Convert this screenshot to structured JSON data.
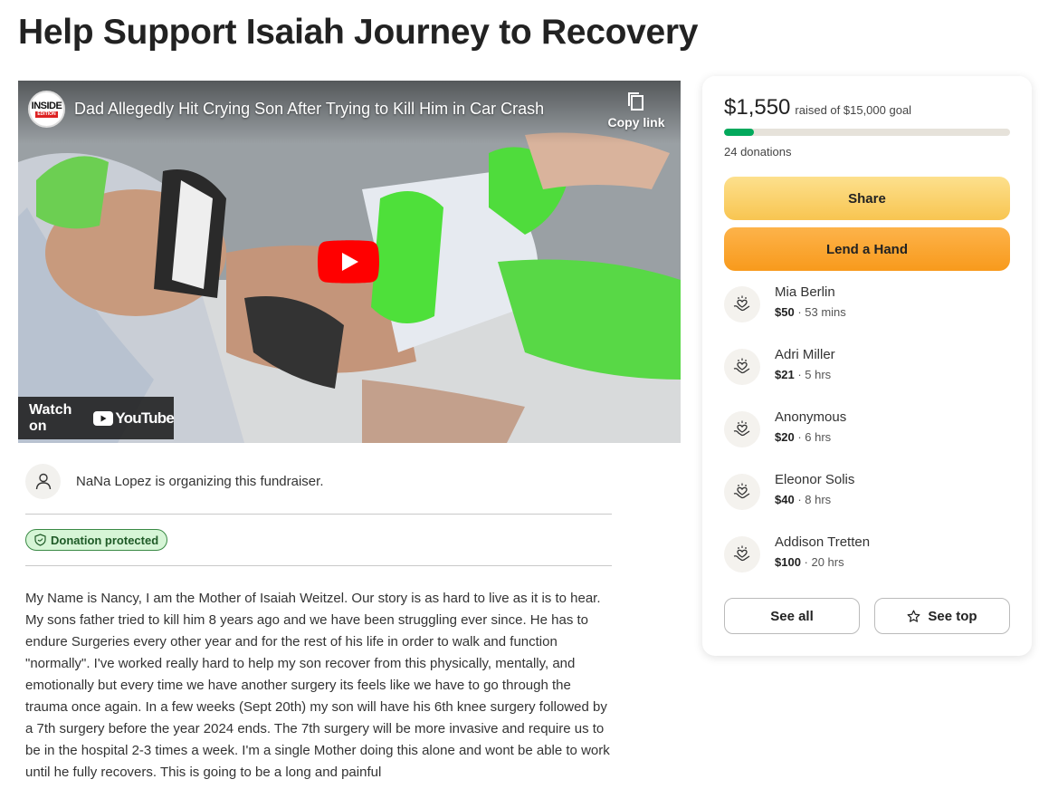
{
  "page": {
    "title": "Help Support Isaiah Journey to Recovery"
  },
  "video": {
    "channel_logo_line1": "INSIDE",
    "channel_logo_line2": "EDITION",
    "title": "Dad Allegedly Hit Crying Son After Trying to Kill Him in Car Crash",
    "copy_link_label": "Copy link",
    "watch_on_label": "Watch on",
    "youtube_wordmark": "YouTube"
  },
  "organizer": {
    "text": "NaNa Lopez is organizing this fundraiser."
  },
  "badge": {
    "label": "Donation protected"
  },
  "story": {
    "text": "My Name is Nancy, I am the Mother of Isaiah Weitzel. Our story is as hard to live as it is to hear. My sons father tried to kill him 8 years ago and we have been struggling ever since. He has to endure Surgeries every other year and for the rest of his life in order to walk and function \"normally\". I've worked really hard to help my son recover from this physically, mentally, and emotionally but every time we have another surgery its feels like we have to go through the trauma once again. In a few weeks (Sept 20th) my son will have his 6th knee surgery followed by a 7th surgery before the year 2024 ends. The 7th surgery will be more invasive and require us to be in the hospital 2-3 times a week. I'm a single Mother doing this alone and wont be able to work until he fully recovers. This is going to be a long and painful"
  },
  "donation_card": {
    "raised_amount": "$1,550",
    "raised_goal_text": "raised of $15,000 goal",
    "progress_fraction": 0.103,
    "donation_count": "24 donations",
    "share_label": "Share",
    "lend_label": "Lend a Hand",
    "donors": [
      {
        "name": "Mia Berlin",
        "amount": "$50",
        "time": " · 53 mins"
      },
      {
        "name": "Adri Miller",
        "amount": "$21",
        "time": " · 5 hrs"
      },
      {
        "name": "Anonymous",
        "amount": "$20",
        "time": " · 6 hrs"
      },
      {
        "name": "Eleonor Solis",
        "amount": "$40",
        "time": " · 8 hrs"
      },
      {
        "name": "Addison Tretten",
        "amount": "$100",
        "time": " · 20 hrs"
      }
    ],
    "see_all_label": "See all",
    "see_top_label": "See top"
  },
  "colors": {
    "progress": "#02a95c",
    "share_button": "#f8c551",
    "lend_button": "#f89a1c",
    "badge_bg": "#d6f5d6",
    "youtube_red": "#ff0000"
  }
}
